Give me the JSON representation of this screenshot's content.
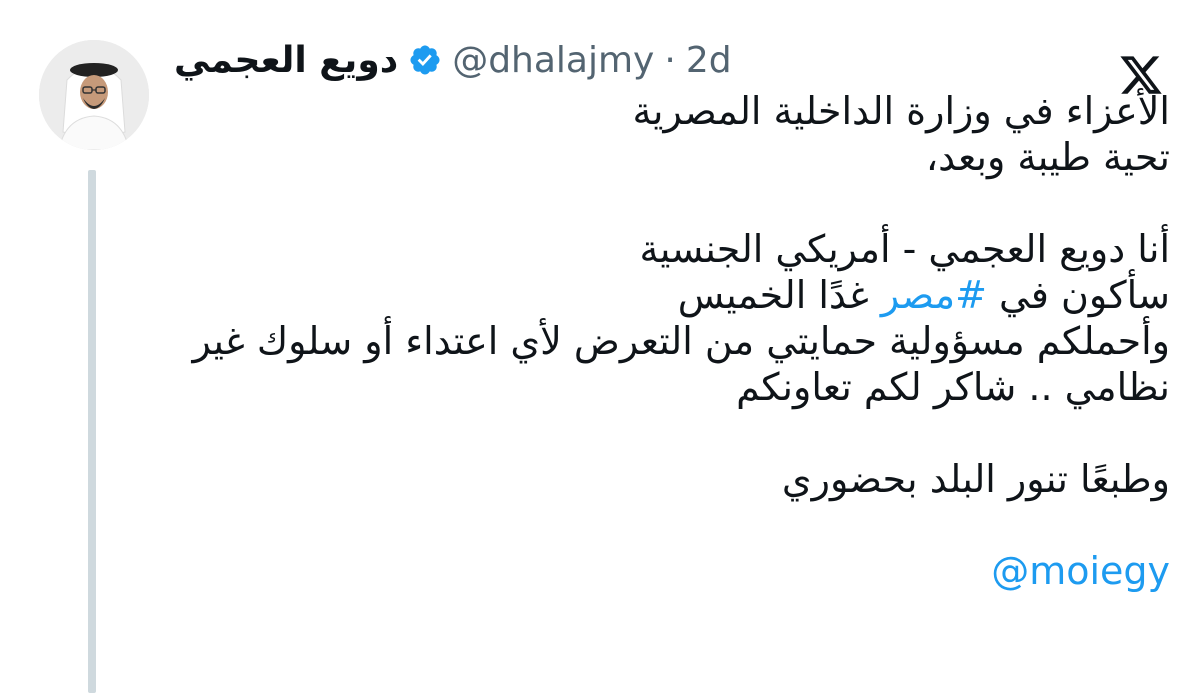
{
  "author": {
    "display_name": "دويع العجمي",
    "verified": true,
    "handle": "@dhalajmy",
    "separator": "·",
    "time": "2d"
  },
  "icons": {
    "verified": "verified-badge-icon",
    "platform": "x-logo-icon",
    "accent_color": "#1d9bf0"
  },
  "tweet": {
    "line1": "الأعزاء في وزارة الداخلية المصرية",
    "line2": "تحية طيبة وبعد،",
    "line3": "أنا دويع العجمي - أمريكي الجنسية",
    "line4_before": "سأكون في ",
    "line4_hashtag": "#مصر",
    "line4_after": " غدًا الخميس",
    "line5": "وأحملكم مسؤولية حمايتي من التعرض لأي اعتداء أو سلوك غير",
    "line6": "نظامي .. شاكر لكم تعاونكم",
    "line7": "وطبعًا تنور البلد بحضوري",
    "mention": "@moiegy"
  }
}
